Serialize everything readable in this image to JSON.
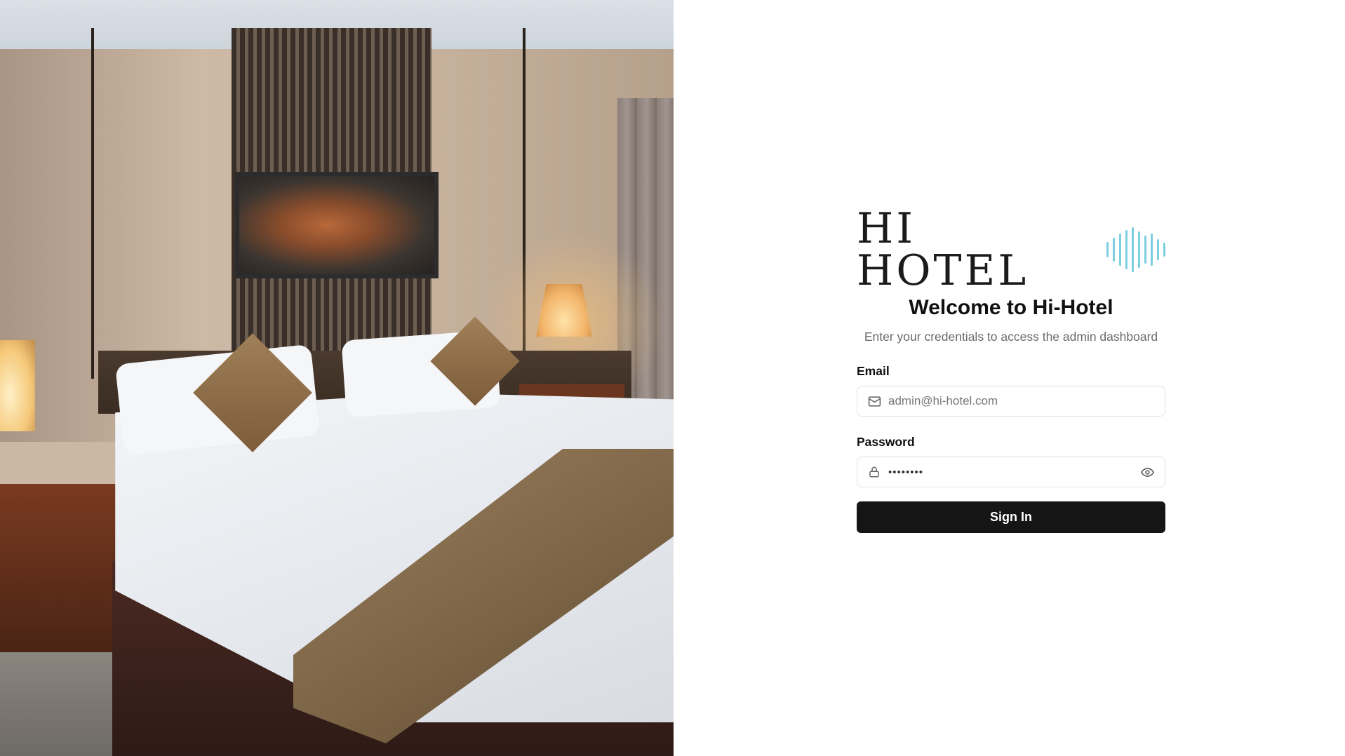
{
  "hero": {
    "alt": "Hotel room with king bed"
  },
  "logo": {
    "text": "HI HOTEL",
    "accent_color": "#7ccfe0"
  },
  "login": {
    "title": "Welcome to Hi-Hotel",
    "subtitle": "Enter your credentials to access the admin dashboard",
    "email_label": "Email",
    "email_placeholder": "admin@hi-hotel.com",
    "email_value": "",
    "password_label": "Password",
    "password_value": "••••••••",
    "submit_label": "Sign In"
  },
  "icons": {
    "email": "mail-icon",
    "password": "lock-icon",
    "toggle": "eye-icon"
  },
  "colors": {
    "button_bg": "#151515",
    "border": "#e2e2e2",
    "muted_text": "#6b6b6b"
  }
}
